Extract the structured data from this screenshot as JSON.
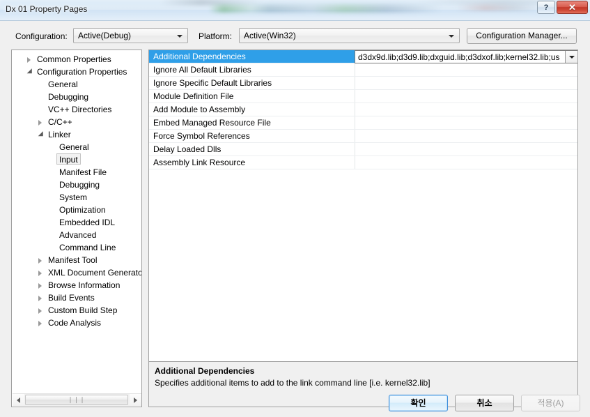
{
  "window": {
    "title": "Dx 01 Property Pages",
    "help_button": "?",
    "close_button": "✕"
  },
  "toolbar": {
    "configuration_label": "Configuration:",
    "configuration_value": "Active(Debug)",
    "platform_label": "Platform:",
    "platform_value": "Active(Win32)",
    "config_manager_label": "Configuration Manager..."
  },
  "tree": {
    "nodes": [
      {
        "label": "Common Properties",
        "indent": 0,
        "state": "collapsed",
        "selected": false
      },
      {
        "label": "Configuration Properties",
        "indent": 0,
        "state": "expanded",
        "selected": false
      },
      {
        "label": "General",
        "indent": 1,
        "state": "leaf",
        "selected": false
      },
      {
        "label": "Debugging",
        "indent": 1,
        "state": "leaf",
        "selected": false
      },
      {
        "label": "VC++ Directories",
        "indent": 1,
        "state": "leaf",
        "selected": false
      },
      {
        "label": "C/C++",
        "indent": 1,
        "state": "collapsed",
        "selected": false
      },
      {
        "label": "Linker",
        "indent": 1,
        "state": "expanded",
        "selected": false
      },
      {
        "label": "General",
        "indent": 2,
        "state": "leaf",
        "selected": false
      },
      {
        "label": "Input",
        "indent": 2,
        "state": "leaf",
        "selected": true
      },
      {
        "label": "Manifest File",
        "indent": 2,
        "state": "leaf",
        "selected": false
      },
      {
        "label": "Debugging",
        "indent": 2,
        "state": "leaf",
        "selected": false
      },
      {
        "label": "System",
        "indent": 2,
        "state": "leaf",
        "selected": false
      },
      {
        "label": "Optimization",
        "indent": 2,
        "state": "leaf",
        "selected": false
      },
      {
        "label": "Embedded IDL",
        "indent": 2,
        "state": "leaf",
        "selected": false
      },
      {
        "label": "Advanced",
        "indent": 2,
        "state": "leaf",
        "selected": false
      },
      {
        "label": "Command Line",
        "indent": 2,
        "state": "leaf",
        "selected": false
      },
      {
        "label": "Manifest Tool",
        "indent": 1,
        "state": "collapsed",
        "selected": false
      },
      {
        "label": "XML Document Generator",
        "indent": 1,
        "state": "collapsed",
        "selected": false
      },
      {
        "label": "Browse Information",
        "indent": 1,
        "state": "collapsed",
        "selected": false
      },
      {
        "label": "Build Events",
        "indent": 1,
        "state": "collapsed",
        "selected": false
      },
      {
        "label": "Custom Build Step",
        "indent": 1,
        "state": "collapsed",
        "selected": false
      },
      {
        "label": "Code Analysis",
        "indent": 1,
        "state": "collapsed",
        "selected": false
      }
    ],
    "scrollbar": {
      "left_arrow": "left-arrow-icon",
      "right_arrow": "right-arrow-icon",
      "grip": "❘❘❘"
    }
  },
  "grid": {
    "rows": [
      {
        "name": "Additional Dependencies",
        "value": "d3dx9d.lib;d3d9.lib;dxguid.lib;d3dxof.lib;kernel32.lib;us",
        "selected": true,
        "editing": true
      },
      {
        "name": "Ignore All Default Libraries",
        "value": "",
        "selected": false,
        "editing": false
      },
      {
        "name": "Ignore Specific Default Libraries",
        "value": "",
        "selected": false,
        "editing": false
      },
      {
        "name": "Module Definition File",
        "value": "",
        "selected": false,
        "editing": false
      },
      {
        "name": "Add Module to Assembly",
        "value": "",
        "selected": false,
        "editing": false
      },
      {
        "name": "Embed Managed Resource File",
        "value": "",
        "selected": false,
        "editing": false
      },
      {
        "name": "Force Symbol References",
        "value": "",
        "selected": false,
        "editing": false
      },
      {
        "name": "Delay Loaded Dlls",
        "value": "",
        "selected": false,
        "editing": false
      },
      {
        "name": "Assembly Link Resource",
        "value": "",
        "selected": false,
        "editing": false
      }
    ],
    "editor_value": "d3dx9d.lib;d3d9.lib;dxguid.lib;d3dxof.lib;kernel32.lib;us"
  },
  "description": {
    "title": "Additional Dependencies",
    "text": "Specifies additional items to add to the link command line [i.e. kernel32.lib]"
  },
  "footer": {
    "ok_label": "확인",
    "cancel_label": "취소",
    "apply_label": "적용(A)"
  },
  "colors": {
    "selection_blue": "#2f9fe8",
    "close_red": "#c3382a",
    "default_button_border": "#3c8ddb"
  }
}
